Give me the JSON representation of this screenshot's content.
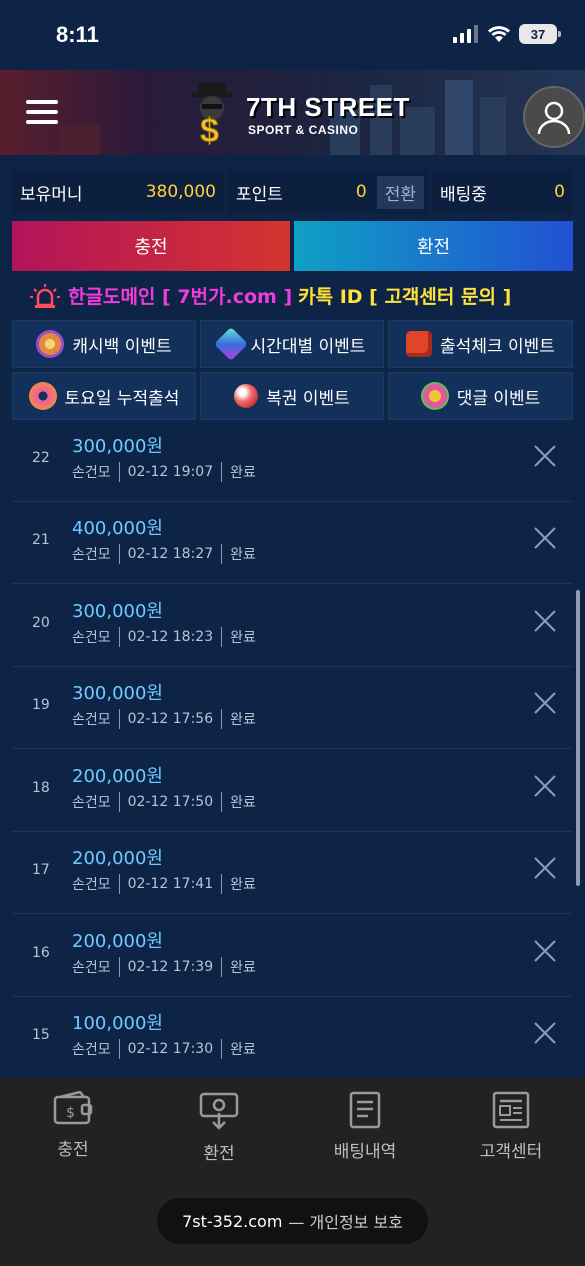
{
  "status_bar": {
    "time": "8:11",
    "battery": "37"
  },
  "header": {
    "logo_title": "7TH STREET",
    "logo_subtitle": "SPORT & CASINO"
  },
  "wallet": {
    "money_label": "보유머니",
    "money_value": "380,000",
    "points_label": "포인트",
    "points_value": "0",
    "convert_label": "전환",
    "betting_label": "배팅중",
    "betting_value": "0"
  },
  "actions": {
    "deposit_label": "충전",
    "withdraw_label": "환전"
  },
  "notice": {
    "part1": "한글도메인 [ 7번가.com ]",
    "part2": "카톡 ID [ 고객센터 문의 ]"
  },
  "events": [
    {
      "label": "캐시백 이벤트",
      "icon": "cashback-icon",
      "color": "#e08a3a"
    },
    {
      "label": "시간대별 이벤트",
      "icon": "gem-icon",
      "color": "#3bb8e0"
    },
    {
      "label": "출석체크 이벤트",
      "icon": "dice-icon",
      "color": "#e0452a"
    },
    {
      "label": "토요일 누적출석",
      "icon": "donut-icon",
      "color": "#f08a4a"
    },
    {
      "label": "복권 이벤트",
      "icon": "ball-icon",
      "color": "#e85050"
    },
    {
      "label": "댓글 이벤트",
      "icon": "ring-icon",
      "color": "#e0589a"
    }
  ],
  "transactions": [
    {
      "num": "22",
      "amount": "300,000원",
      "name": "손건모",
      "datetime": "02-12 19:07",
      "status": "완료"
    },
    {
      "num": "21",
      "amount": "400,000원",
      "name": "손건모",
      "datetime": "02-12 18:27",
      "status": "완료"
    },
    {
      "num": "20",
      "amount": "300,000원",
      "name": "손건모",
      "datetime": "02-12 18:23",
      "status": "완료"
    },
    {
      "num": "19",
      "amount": "300,000원",
      "name": "손건모",
      "datetime": "02-12 17:56",
      "status": "완료"
    },
    {
      "num": "18",
      "amount": "200,000원",
      "name": "손건모",
      "datetime": "02-12 17:50",
      "status": "완료"
    },
    {
      "num": "17",
      "amount": "200,000원",
      "name": "손건모",
      "datetime": "02-12 17:41",
      "status": "완료"
    },
    {
      "num": "16",
      "amount": "200,000원",
      "name": "손건모",
      "datetime": "02-12 17:39",
      "status": "완료"
    },
    {
      "num": "15",
      "amount": "100,000원",
      "name": "손건모",
      "datetime": "02-12 17:30",
      "status": "완료"
    }
  ],
  "tabs": [
    {
      "label": "충전",
      "icon": "wallet-icon"
    },
    {
      "label": "환전",
      "icon": "exchange-icon"
    },
    {
      "label": "배팅내역",
      "icon": "document-icon"
    },
    {
      "label": "고객센터",
      "icon": "newspaper-icon"
    }
  ],
  "browser": {
    "domain": "7st-352.com",
    "suffix": "— 개인정보 보호"
  }
}
